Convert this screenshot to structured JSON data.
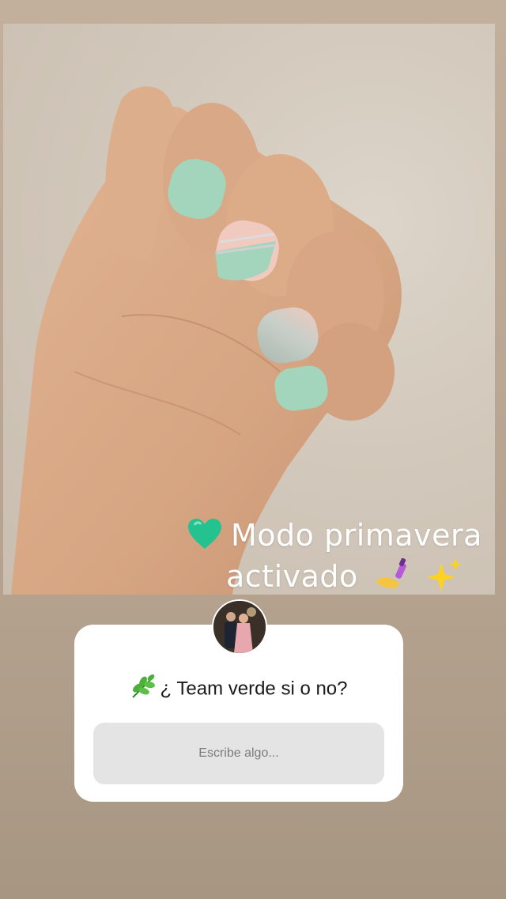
{
  "story": {
    "caption": {
      "line1": "Modo primavera",
      "line2": "activado",
      "emoji_before": "green-heart-icon",
      "emoji_after": [
        "nail-polish-icon",
        "sparkles-icon"
      ]
    },
    "question_sticker": {
      "avatar": "profile-avatar",
      "question": "¿ Team verde si o no?",
      "question_emoji": "herb-icon",
      "answer_placeholder": "Escribe algo..."
    }
  },
  "colors": {
    "nail_mint": "#9fd3bb",
    "card_background": "#ffffff",
    "input_background": "#e4e4e4",
    "heart": "#23c28f"
  }
}
